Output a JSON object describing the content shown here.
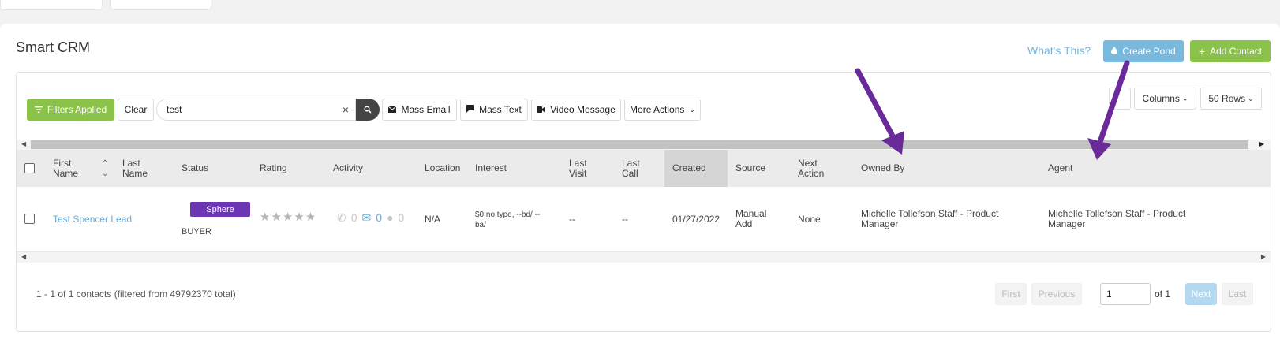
{
  "page": {
    "title": "Smart CRM",
    "whats_this": "What's This?",
    "create_pond": "Create Pond",
    "add_contact": "Add Contact"
  },
  "toolbar": {
    "filters_label": "Filters Applied",
    "clear_label": "Clear",
    "search_value": "test",
    "mass_email": "Mass Email",
    "mass_text": "Mass Text",
    "video_message": "Video Message",
    "more_actions": "More Actions",
    "columns": "Columns",
    "rows": "50 Rows"
  },
  "table": {
    "headers": {
      "first_name_1": "First",
      "first_name_2": "Name",
      "last_name_1": "Last",
      "last_name_2": "Name",
      "status": "Status",
      "rating": "Rating",
      "activity": "Activity",
      "location": "Location",
      "interest": "Interest",
      "last_visit_1": "Last",
      "last_visit_2": "Visit",
      "last_call_1": "Last",
      "last_call_2": "Call",
      "created": "Created",
      "source": "Source",
      "next_action_1": "Next",
      "next_action_2": "Action",
      "owned_by": "Owned By",
      "agent": "Agent"
    },
    "rows": [
      {
        "name": "Test Spencer Lead",
        "status_tag": "Sphere",
        "status_sub": "BUYER",
        "rating": "★★★★★",
        "activity_phone": "0",
        "activity_email": "0",
        "activity_chat": "0",
        "location": "N/A",
        "interest_1": "$0 no type, --bd/ --",
        "interest_2": "ba/",
        "last_visit": "--",
        "last_call": "--",
        "created": "01/27/2022",
        "source_1": "Manual",
        "source_2": "Add",
        "next_action": "None",
        "owned_by_1": "Michelle Tollefson Staff - Product",
        "owned_by_2": "Manager",
        "agent_1": "Michelle Tollefson Staff - Product",
        "agent_2": "Manager"
      }
    ]
  },
  "footer": {
    "summary": "1 - 1 of 1 contacts (filtered from 49792370 total)",
    "first": "First",
    "previous": "Previous",
    "page_value": "1",
    "of_label": "of 1",
    "next": "Next",
    "last": "Last"
  },
  "colors": {
    "green": "#8bc34a",
    "blue": "#7ab9de",
    "purple_tag": "#6b35b3",
    "annotation_arrow": "#6a2a9a"
  }
}
